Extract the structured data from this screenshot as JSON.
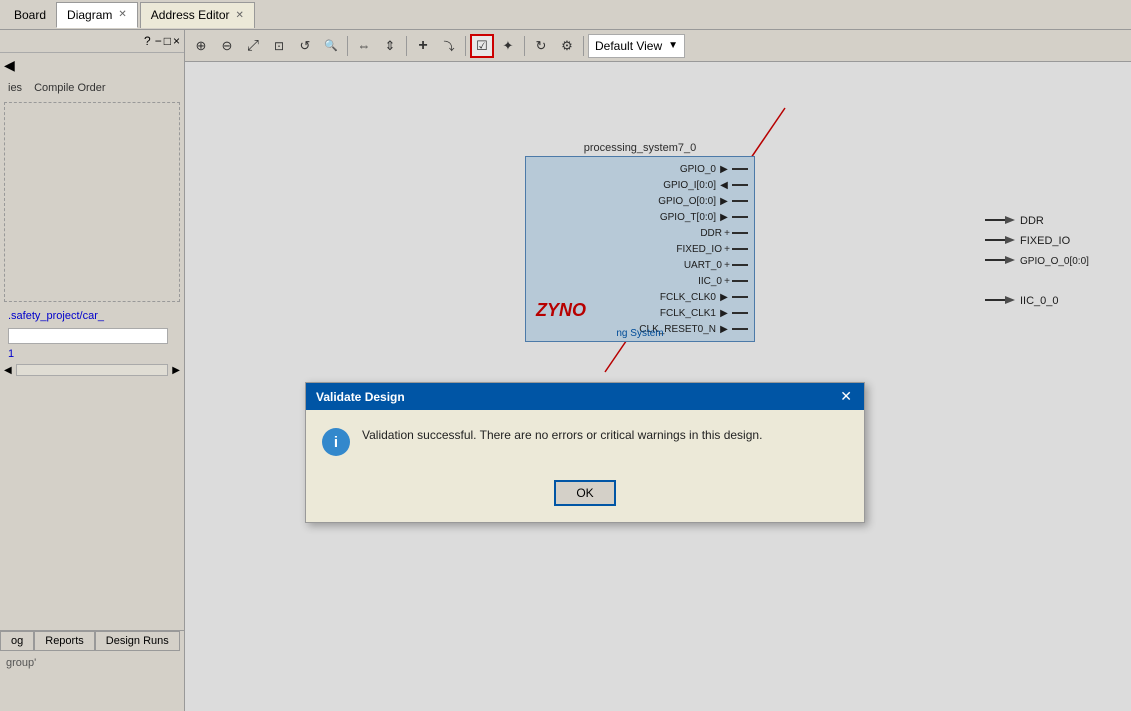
{
  "tabs": [
    {
      "label": "Board",
      "active": false,
      "closable": false
    },
    {
      "label": "Diagram",
      "active": true,
      "closable": true
    },
    {
      "label": "Address Editor",
      "active": false,
      "closable": true
    }
  ],
  "toolbar": {
    "buttons": [
      {
        "name": "zoom-in",
        "icon": "⊕",
        "tooltip": "Zoom In"
      },
      {
        "name": "zoom-out",
        "icon": "⊖",
        "tooltip": "Zoom Out"
      },
      {
        "name": "fit-all",
        "icon": "⤢",
        "tooltip": "Fit"
      },
      {
        "name": "fit-selection",
        "icon": "⊡",
        "tooltip": "Fit Selection"
      },
      {
        "name": "refresh",
        "icon": "↺",
        "tooltip": "Refresh"
      },
      {
        "name": "search",
        "icon": "🔍",
        "tooltip": "Search"
      },
      {
        "name": "align-h",
        "icon": "⇔",
        "tooltip": "Align Horizontal"
      },
      {
        "name": "align-v",
        "icon": "⇕",
        "tooltip": "Align Vertical"
      },
      {
        "name": "add",
        "icon": "+",
        "tooltip": "Add"
      },
      {
        "name": "connect",
        "icon": "⤵",
        "tooltip": "Connect"
      },
      {
        "name": "validate",
        "icon": "☑",
        "tooltip": "Validate",
        "active": true
      },
      {
        "name": "route",
        "icon": "✦",
        "tooltip": "Route"
      },
      {
        "name": "regenerate",
        "icon": "↻",
        "tooltip": "Regenerate"
      },
      {
        "name": "settings2",
        "icon": "⚙",
        "tooltip": "Settings"
      }
    ],
    "view_dropdown": "Default View"
  },
  "diagram": {
    "block_title": "processing_system7_0",
    "ports": [
      {
        "name": "GPIO_0",
        "dir": "out",
        "plus": false
      },
      {
        "name": "GPIO_I[0:0]",
        "dir": "in",
        "plus": false
      },
      {
        "name": "GPIO_O[0:0]",
        "dir": "out",
        "plus": false
      },
      {
        "name": "GPIO_T[0:0]",
        "dir": "out",
        "plus": false
      },
      {
        "name": "DDR",
        "dir": "out",
        "plus": true
      },
      {
        "name": "FIXED_IO",
        "dir": "out",
        "plus": true
      },
      {
        "name": "UART_0",
        "dir": "out",
        "plus": true
      },
      {
        "name": "IIC_0",
        "dir": "out",
        "plus": true
      },
      {
        "name": "FCLK_CLK0",
        "dir": "out",
        "plus": false
      },
      {
        "name": "FCLK_CLK1",
        "dir": "out",
        "plus": false
      },
      {
        "name": "CLK_RESET0_N",
        "dir": "out",
        "plus": false
      }
    ],
    "ext_ports": [
      {
        "label": "DDR"
      },
      {
        "label": "FIXED_IO"
      },
      {
        "label": "GPIO_O_0[0:0]"
      },
      {
        "label": "IIC_0_0"
      }
    ],
    "zynq_logo": "ZYNO",
    "processing_system_label": "ng System"
  },
  "sidebar": {
    "gear_icon": "⚙",
    "question_icon": "?",
    "minimize_icon": "−",
    "restore_icon": "□",
    "close_icon": "×",
    "nav_labels": [
      "ies",
      "Compile Order"
    ],
    "path": ".safety_project/car_",
    "link": "1",
    "scroll_left": "◀",
    "scroll_right": "▶"
  },
  "bottom_tabs": [
    {
      "label": "og",
      "active": false
    },
    {
      "label": "Reports",
      "active": false
    },
    {
      "label": "Design Runs",
      "active": false
    }
  ],
  "bottom_footer": "group'",
  "dialog": {
    "title": "Validate Design",
    "message": "Validation successful. There are no errors or critical warnings in this design.",
    "ok_label": "OK",
    "info_symbol": "i"
  }
}
